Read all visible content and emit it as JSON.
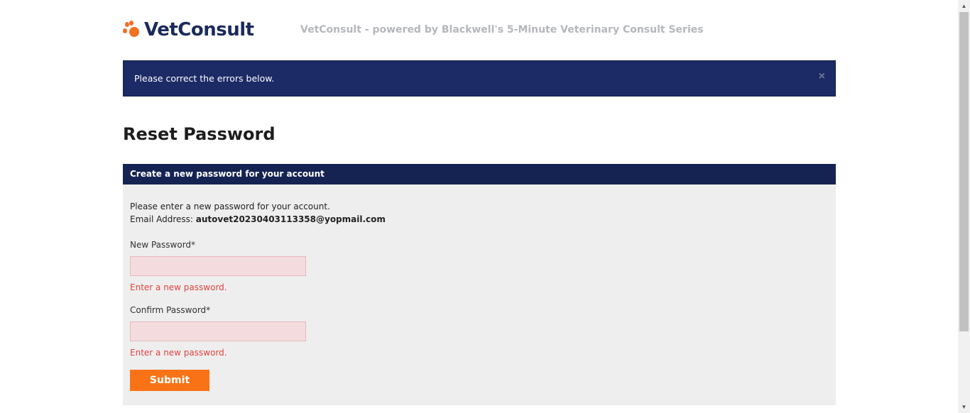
{
  "header": {
    "logo_text": "VetConsult",
    "tagline": "VetConsult - powered by Blackwell's 5-Minute Veterinary Consult Series"
  },
  "alert": {
    "message": "Please correct the errors below.",
    "close_symbol": "×"
  },
  "page_title": "Reset Password",
  "panel": {
    "heading": "Create a new password for your account",
    "intro_line": "Please enter a new password for your account.",
    "email_label": "Email Address:",
    "email_value": "autovet20230403113358@yopmail.com",
    "new_password": {
      "label": "New Password*",
      "value": "",
      "error": "Enter a new password."
    },
    "confirm_password": {
      "label": "Confirm Password*",
      "value": "",
      "error": "Enter a new password."
    },
    "submit_label": "Submit"
  },
  "colors": {
    "brand_orange": "#f97316",
    "navy": "#1c2a66",
    "error_red": "#e0443f",
    "input_error_bg": "#f4dcde"
  },
  "scrollbar": {
    "up_symbol": "▲",
    "down_symbol": "▼"
  }
}
